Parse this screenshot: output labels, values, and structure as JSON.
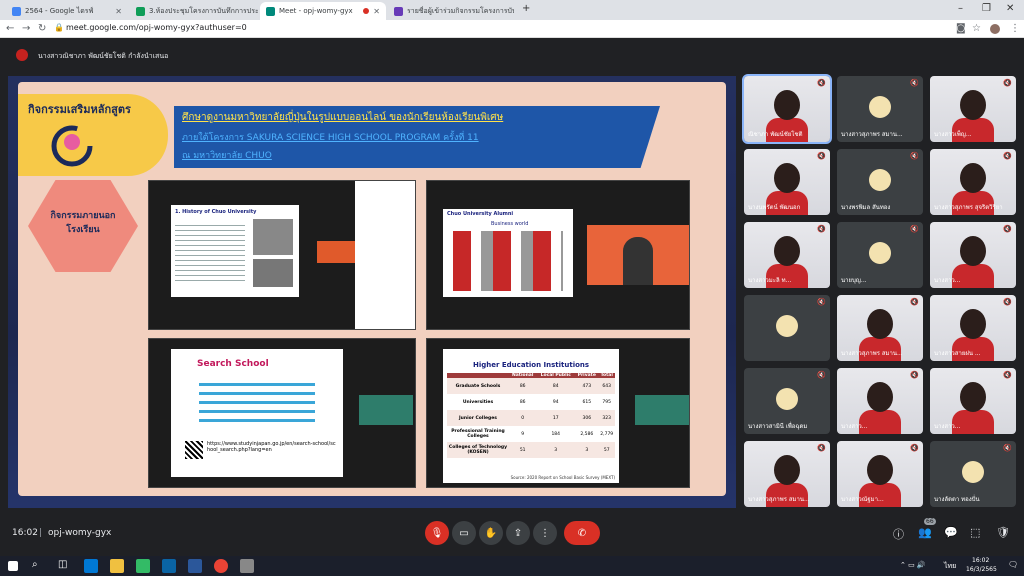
{
  "tabs": [
    {
      "label": "2564 - Google ไดรฟ์",
      "color": "#4285f4"
    },
    {
      "label": "3.ห้องประชุมโครงการบันทึกการประชุม",
      "color": "#0f9d58"
    },
    {
      "label": "Meet - opj-womy-gyx",
      "color": "#00897b",
      "active": true
    },
    {
      "label": "รายชื่อผู้เข้าร่วมกิจกรรมโครงการบันทึก",
      "color": "#673ab7"
    }
  ],
  "browser": {
    "url": "meet.google.com/opj-womy-gyx?authuser=0"
  },
  "presenter": {
    "text": "นางสาวณิชาภา พัฒน์ชัยโชติ กำลังนำเสนอ"
  },
  "slide": {
    "badge": "กิจกรรมเสริมหลักสูตร",
    "hex": "กิจกรรมภายนอก\nโรงเรียน",
    "title_line1": "ศึกษาดูงานมหาวิทยาลัยญี่ปุ่นในรูปแบบออนไลน์ ของนักเรียนห้องเรียนพิเศษ",
    "title_line2": "ภายใต้โครงการ SAKURA SCIENCE HIGH SCHOOL PROGRAM ครั้งที่ 11",
    "title_line3": "ณ มหาวิทยาลัย CHUO"
  },
  "panels": {
    "p1_title": "1. History of Chuo University",
    "p2_title": "Chuo University Alumni",
    "p2_sub": "Business world",
    "p3_title": "Search School",
    "p3_url": "https://www.studyinjapan.go.jp/en/search-school/school_search.php?lang=en",
    "p4_title": "Higher Education Institutions",
    "table_headers": [
      "",
      "National",
      "Local Public",
      "Private",
      "Total"
    ],
    "table_rows": [
      [
        "Graduate Schools",
        "86",
        "84",
        "473",
        "643"
      ],
      [
        "Universities",
        "86",
        "94",
        "615",
        "795"
      ],
      [
        "Junior Colleges",
        "0",
        "17",
        "306",
        "323"
      ],
      [
        "Professional Training Colleges",
        "9",
        "184",
        "2,586",
        "2,779"
      ],
      [
        "Colleges of Technology (KOSEN)",
        "51",
        "3",
        "3",
        "57"
      ]
    ],
    "table_source": "Source: 2020 Report on School Basic Survey (MEXT)"
  },
  "participants": [
    {
      "name": "ณิชาภา พัฒน์ชัยโชติ"
    },
    {
      "name": "นางสาวสุภาพร สมาน..."
    },
    {
      "name": "นางสาวเพ็ญ..."
    },
    {
      "name": "นางนพรัตน์ พัฒนอก"
    },
    {
      "name": "นางพรพิมล สันทอง"
    },
    {
      "name": "นางสาวสุภาพร สุจริตวิริยา"
    },
    {
      "name": "นางสาวมะลิ ท..."
    },
    {
      "name": "นายบุญ..."
    },
    {
      "name": "นางสาว..."
    },
    {
      "name": ""
    },
    {
      "name": "นางสาวสุภาพร สมาน..."
    },
    {
      "name": "นางสาวสายฝน ..."
    },
    {
      "name": "นางสาวสามินี เพื่อฉุดม"
    },
    {
      "name": "นางสาว..."
    },
    {
      "name": "นางสาว..."
    },
    {
      "name": "นางสาวสุภาพร สมาน..."
    },
    {
      "name": "นางสาวณัฐมา..."
    },
    {
      "name": "นางลัดดา ทองปั่น"
    },
    {
      "name": "ณรงค์ชัย หล่อประเสริฐ"
    },
    {
      "name": "อีก 37 คน"
    },
    {
      "name": ""
    }
  ],
  "bottom": {
    "time": "16:02",
    "code": "opj-womy-gyx",
    "badge_count": "66"
  },
  "taskbar": {
    "time": "16:02",
    "date": "16/3/2565",
    "lang": "ไทย"
  }
}
